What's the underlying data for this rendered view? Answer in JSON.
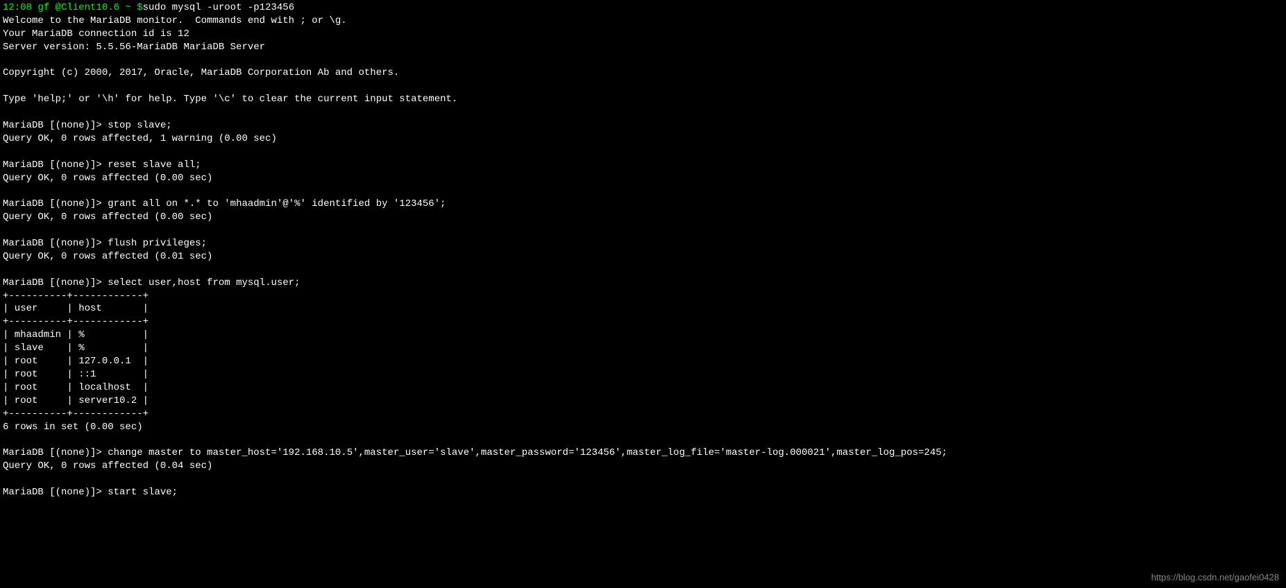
{
  "prompt": {
    "time": "12:08",
    "user_host": " gf @Client10.6 ~ ",
    "dollar": "$",
    "command": "sudo mysql -uroot -p123456"
  },
  "banner": {
    "l1": "Welcome to the MariaDB monitor.  Commands end with ; or \\g.",
    "l2": "Your MariaDB connection id is 12",
    "l3": "Server version: 5.5.56-MariaDB MariaDB Server",
    "l4": "Copyright (c) 2000, 2017, Oracle, MariaDB Corporation Ab and others.",
    "l5": "Type 'help;' or '\\h' for help. Type '\\c' to clear the current input statement."
  },
  "sql_prompt": "MariaDB [(none)]> ",
  "cmd1": {
    "q": "stop slave;",
    "r": "Query OK, 0 rows affected, 1 warning (0.00 sec)"
  },
  "cmd2": {
    "q": "reset slave all;",
    "r": "Query OK, 0 rows affected (0.00 sec)"
  },
  "cmd3": {
    "q": "grant all on *.* to 'mhaadmin'@'%' identified by '123456';",
    "r": "Query OK, 0 rows affected (0.00 sec)"
  },
  "cmd4": {
    "q": "flush privileges;",
    "r": "Query OK, 0 rows affected (0.01 sec)"
  },
  "cmd5": {
    "q": "select user,host from mysql.user;",
    "border": "+----------+------------+",
    "header": "| user     | host       |",
    "rows": {
      "r0": "| mhaadmin | %          |",
      "r1": "| slave    | %          |",
      "r2": "| root     | 127.0.0.1  |",
      "r3": "| root     | ::1        |",
      "r4": "| root     | localhost  |",
      "r5": "| root     | server10.2 |"
    },
    "summary": "6 rows in set (0.00 sec)"
  },
  "cmd6": {
    "q": "change master to master_host='192.168.10.5',master_user='slave',master_password='123456',master_log_file='master-log.000021',master_log_pos=245;",
    "r": "Query OK, 0 rows affected (0.04 sec)"
  },
  "cmd7": {
    "q": "start slave;"
  },
  "watermark": "https://blog.csdn.net/gaofei0428"
}
